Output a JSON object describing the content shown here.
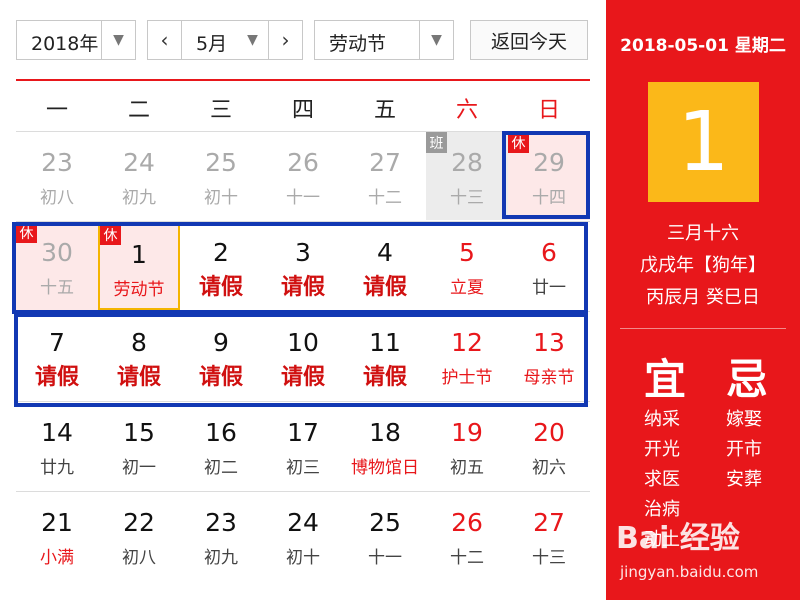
{
  "toolbar": {
    "year_value": "2018年",
    "month_value": "5月",
    "holiday_value": "劳动节",
    "today_label": "返回今天"
  },
  "weekdays": [
    "一",
    "二",
    "三",
    "四",
    "五",
    "六",
    "日"
  ],
  "weeks": [
    [
      {
        "day": "23",
        "lunar": "初八",
        "cls": "other"
      },
      {
        "day": "24",
        "lunar": "初九",
        "cls": "other"
      },
      {
        "day": "25",
        "lunar": "初十",
        "cls": "other"
      },
      {
        "day": "26",
        "lunar": "十一",
        "cls": "other"
      },
      {
        "day": "27",
        "lunar": "十二",
        "cls": "other"
      },
      {
        "day": "28",
        "lunar": "十三",
        "cls": "other work-bg",
        "badge": "班",
        "badge_type": "work"
      },
      {
        "day": "29",
        "lunar": "十四",
        "cls": "other rest-bg",
        "badge": "休",
        "badge_type": "rest"
      }
    ],
    [
      {
        "day": "30",
        "lunar": "十五",
        "cls": "other rest-bg",
        "badge": "休",
        "badge_type": "rest"
      },
      {
        "day": "1",
        "lunar": "劳动节",
        "cls": "selected festival",
        "badge": "休",
        "badge_type": "rest"
      },
      {
        "day": "2",
        "lunar": "请假",
        "cls": "leave"
      },
      {
        "day": "3",
        "lunar": "请假",
        "cls": "leave"
      },
      {
        "day": "4",
        "lunar": "请假",
        "cls": "leave"
      },
      {
        "day": "5",
        "lunar": "立夏",
        "cls": "wknd festival"
      },
      {
        "day": "6",
        "lunar": "廿一",
        "cls": "wknd"
      }
    ],
    [
      {
        "day": "7",
        "lunar": "请假",
        "cls": "leave"
      },
      {
        "day": "8",
        "lunar": "请假",
        "cls": "leave"
      },
      {
        "day": "9",
        "lunar": "请假",
        "cls": "leave"
      },
      {
        "day": "10",
        "lunar": "请假",
        "cls": "leave"
      },
      {
        "day": "11",
        "lunar": "请假",
        "cls": "leave"
      },
      {
        "day": "12",
        "lunar": "护士节",
        "cls": "wknd festival"
      },
      {
        "day": "13",
        "lunar": "母亲节",
        "cls": "wknd festival"
      }
    ],
    [
      {
        "day": "14",
        "lunar": "廿九",
        "cls": ""
      },
      {
        "day": "15",
        "lunar": "初一",
        "cls": ""
      },
      {
        "day": "16",
        "lunar": "初二",
        "cls": ""
      },
      {
        "day": "17",
        "lunar": "初三",
        "cls": ""
      },
      {
        "day": "18",
        "lunar": "博物馆日",
        "cls": "festival"
      },
      {
        "day": "19",
        "lunar": "初五",
        "cls": "wknd"
      },
      {
        "day": "20",
        "lunar": "初六",
        "cls": "wknd"
      }
    ],
    [
      {
        "day": "21",
        "lunar": "小满",
        "cls": "festival"
      },
      {
        "day": "22",
        "lunar": "初八",
        "cls": ""
      },
      {
        "day": "23",
        "lunar": "初九",
        "cls": ""
      },
      {
        "day": "24",
        "lunar": "初十",
        "cls": ""
      },
      {
        "day": "25",
        "lunar": "十一",
        "cls": ""
      },
      {
        "day": "26",
        "lunar": "十二",
        "cls": "wknd"
      },
      {
        "day": "27",
        "lunar": "十三",
        "cls": "wknd"
      }
    ]
  ],
  "panel": {
    "date_line": "2018-05-01 星期二",
    "big_day": "1",
    "lunar_date": "三月十六",
    "year_gz": "戊戌年【狗年】",
    "month_day_gz": "丙辰月 癸巳日",
    "yi_label": "宜",
    "ji_label": "忌",
    "yi_items": [
      "纳采",
      "开光",
      "求医",
      "治病",
      "动土"
    ],
    "ji_items": [
      "嫁娶",
      "开市",
      "安葬"
    ]
  },
  "watermark": {
    "brand": "Bai 经验",
    "url": "jingyan.baidu.com"
  },
  "colors": {
    "accent_red": "#e8171b",
    "today_yellow": "#fbb819",
    "highlight_blue": "#1238b3"
  }
}
